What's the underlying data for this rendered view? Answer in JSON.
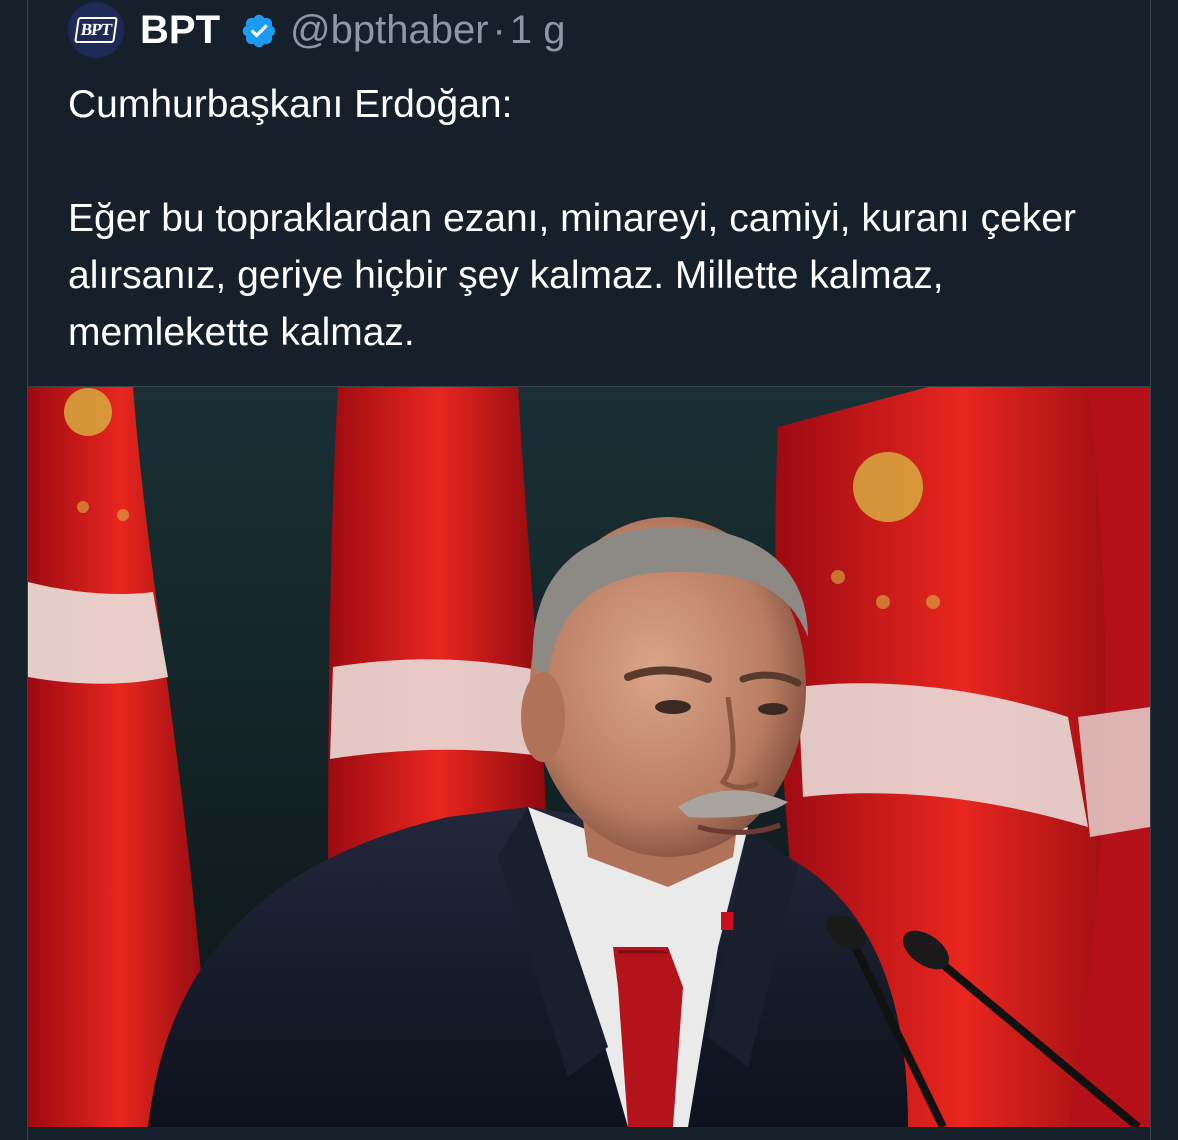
{
  "tweet": {
    "author": {
      "display_name": "BPT",
      "handle": "@bpthaber",
      "separator": "·",
      "time_ago": "1 g",
      "avatar_text": "BPT",
      "verified": true,
      "verified_icon": "verified-badge-icon"
    },
    "text": {
      "line1": "Cumhurbaşkanı Erdoğan:",
      "line2": "Eğer bu topraklardan ezanı, minareyi, camiyi, kuranı çeker alırsanız, geriye hiçbir şey kalmaz. Millette kalmaz, memlekette kalmaz."
    },
    "media": {
      "type": "photo"
    },
    "colors": {
      "background": "#15202b",
      "text": "#ffffff",
      "secondary": "#8b98a5",
      "verified": "#1d9bf0",
      "flag_red": "#e30a17"
    }
  }
}
